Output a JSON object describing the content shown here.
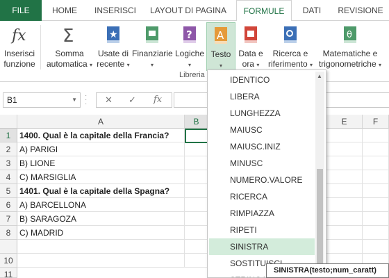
{
  "tabs": [
    "FILE",
    "HOME",
    "INSERISCI",
    "LAYOUT DI PAGINA",
    "FORMULE",
    "DATI",
    "REVISIONE"
  ],
  "ribbon": {
    "buttons": [
      {
        "line1": "Inserisci",
        "line2": "funzione",
        "icon": "fx-icon"
      },
      {
        "line1": "Somma",
        "line2": "automatica",
        "icon": "sigma-icon"
      },
      {
        "line1": "Usate di",
        "line2": "recente",
        "icon": "star-book-icon"
      },
      {
        "line1": "Finanziarie",
        "line2": "",
        "icon": "finance-book-icon"
      },
      {
        "line1": "Logiche",
        "line2": "",
        "icon": "question-book-icon"
      },
      {
        "line1": "Testo",
        "line2": "",
        "icon": "text-book-icon"
      },
      {
        "line1": "Data e",
        "line2": "ora",
        "icon": "calendar-book-icon"
      },
      {
        "line1": "Ricerca e",
        "line2": "riferimento",
        "icon": "search-book-icon"
      },
      {
        "line1": "Matematiche e",
        "line2": "trigonometriche",
        "icon": "theta-book-icon"
      }
    ],
    "group_label": "Libreria"
  },
  "colors": {
    "accent": "#217346",
    "highlight": "#d3ecdb"
  },
  "formula_bar": {
    "name_box": "B1",
    "cancel": "✕",
    "enter": "✓",
    "fx": "fx",
    "value": ""
  },
  "grid": {
    "columns": [
      "A",
      "B",
      "E",
      "F"
    ],
    "rows": [
      "1",
      "2",
      "3",
      "4",
      "5",
      "6",
      "7",
      "8",
      "10",
      "11"
    ],
    "cells": [
      "1400. Qual è la capitale della Francia?",
      "A) PARIGI",
      "B) LIONE",
      "C) MARSIGLIA",
      "1401. Qual è la capitale della Spagna?",
      "A) BARCELLONA",
      "B) SARAGOZA",
      "C) MADRID"
    ]
  },
  "dropdown": {
    "items": [
      "IDENTICO",
      "LIBERA",
      "LUNGHEZZA",
      "MAIUSC",
      "MAIUSC.INIZ",
      "MINUSC",
      "NUMERO.VALORE",
      "RICERCA",
      "RIMPIAZZA",
      "RIPETI",
      "SINISTRA",
      "SOSTITUISCI",
      "STRINGA"
    ],
    "selected": "SINISTRA"
  },
  "tooltip": "SINISTRA(testo;num_caratt)"
}
